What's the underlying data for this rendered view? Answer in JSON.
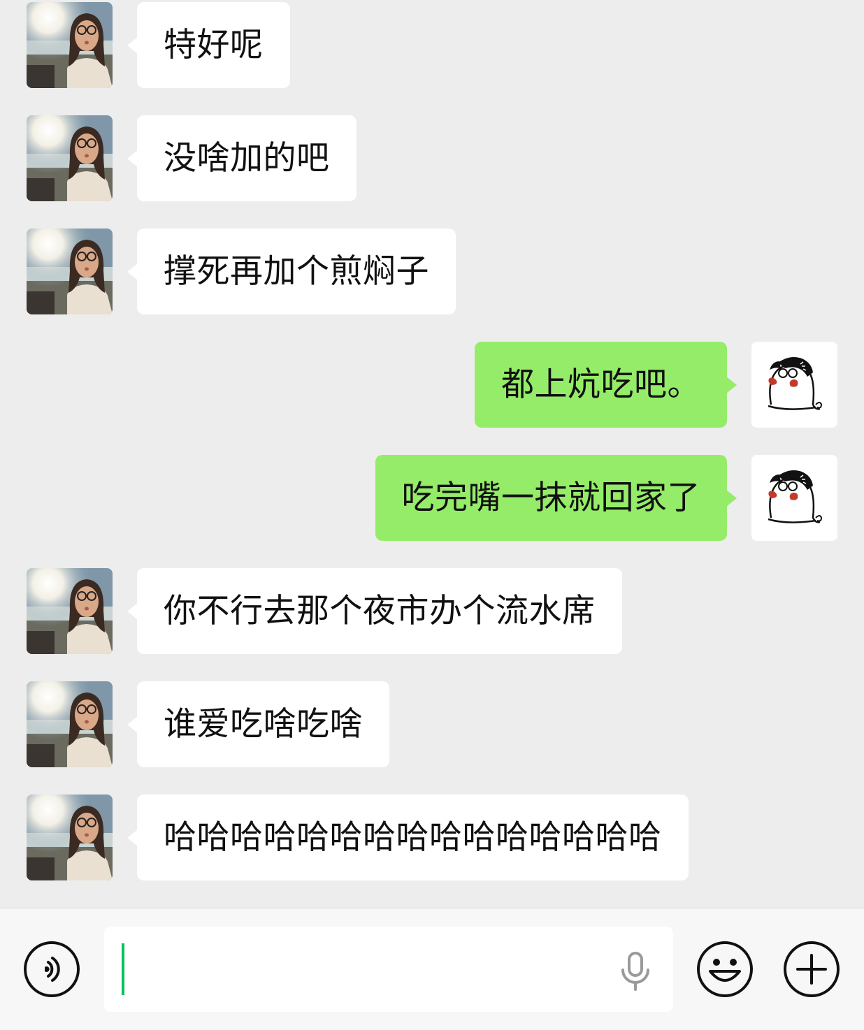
{
  "messages": [
    {
      "side": "in",
      "text": "特好呢",
      "avatar": "friend-photo"
    },
    {
      "side": "in",
      "text": "没啥加的吧",
      "avatar": "friend-photo"
    },
    {
      "side": "in",
      "text": "撑死再加个煎焖子",
      "avatar": "friend-photo"
    },
    {
      "side": "out",
      "text": "都上炕吃吧。",
      "avatar": "cartoon-ghost-with-glasses"
    },
    {
      "side": "out",
      "text": "吃完嘴一抹就回家了",
      "avatar": "cartoon-ghost-with-glasses"
    },
    {
      "side": "in",
      "text": "你不行去那个夜市办个流水席",
      "avatar": "friend-photo"
    },
    {
      "side": "in",
      "text": "谁爱吃啥吃啥",
      "avatar": "friend-photo"
    },
    {
      "side": "in",
      "text": "哈哈哈哈哈哈哈哈哈哈哈哈哈哈哈",
      "avatar": "friend-photo"
    }
  ],
  "input": {
    "value": "",
    "voice_button_icon": "voice-toggle-icon",
    "mic_icon": "microphone-icon",
    "emoji_icon": "emoji-smile-icon",
    "more_icon": "plus-circle-icon"
  },
  "colors": {
    "background": "#ededed",
    "incoming_bubble": "#ffffff",
    "outgoing_bubble": "#95ec69",
    "caret": "#07c160"
  }
}
